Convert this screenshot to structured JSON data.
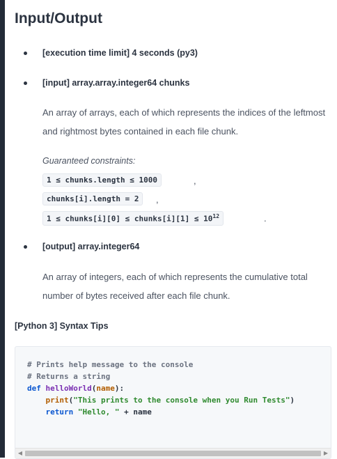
{
  "section_title": "Input/Output",
  "items": {
    "exec_limit": "[execution time limit] 4 seconds (py3)",
    "input_label": "[input] array.array.integer64 chunks",
    "input_desc": "An array of arrays, each of which represents the indices of the leftmost and rightmost bytes contained in each file chunk.",
    "constraints_title": "Guaranteed constraints:",
    "constraint_1": "1 ≤ chunks.length ≤ 1000",
    "constraint_2": "chunks[i].length = 2",
    "constraint_3_base": "1 ≤ chunks[i][0] ≤ chunks[i][1] ≤ 10",
    "constraint_3_exp": "12",
    "output_label": "[output] array.integer64",
    "output_desc": "An array of integers, each of which represents the cumulative total number of bytes received after each file chunk."
  },
  "tips_title": "[Python 3] Syntax Tips",
  "code": {
    "line1": "# Prints help message to the console",
    "line2": "# Returns a string",
    "line3_kw": "def",
    "line3_fn": "helloWorld",
    "line3_arg": "name",
    "line4_fn": "print",
    "line4_str": "\"This prints to the console when you Run Tests\"",
    "line5_kw": "return",
    "line5_str": "\"Hello, \"",
    "line5_rest": " + name"
  },
  "separators": {
    "comma": ",",
    "period": "."
  }
}
